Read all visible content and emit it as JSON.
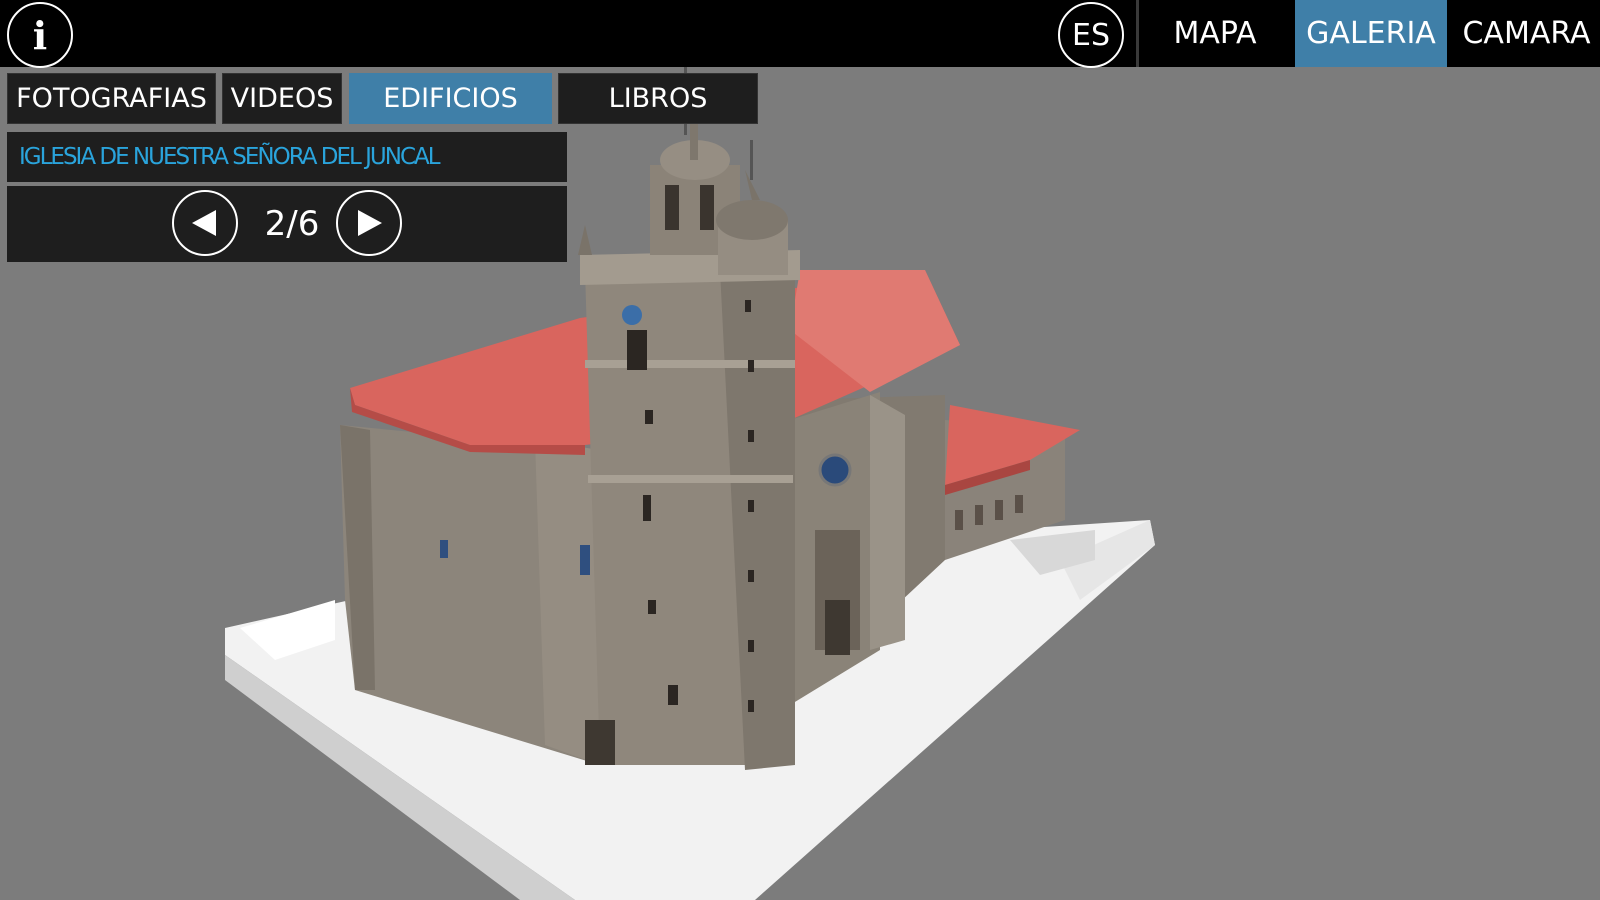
{
  "topbar": {
    "info_icon": "info-icon",
    "language": "ES",
    "nav": [
      {
        "label": "MAPA",
        "active": false
      },
      {
        "label": "GALERIA",
        "active": true
      },
      {
        "label": "CAMARA",
        "active": false
      }
    ]
  },
  "subtabs": [
    {
      "label": "FOTOGRAFIAS",
      "active": false
    },
    {
      "label": "VIDEOS",
      "active": false
    },
    {
      "label": "EDIFICIOS",
      "active": true
    },
    {
      "label": "LIBROS",
      "active": false
    }
  ],
  "building": {
    "title": "IGLESIA DE NUESTRA SEÑORA DEL JUNCAL",
    "pager": {
      "counter": "2/6",
      "prev_icon": "triangle-left-icon",
      "next_icon": "triangle-right-icon"
    }
  },
  "colors": {
    "accent": "#3f7fa8",
    "title_text": "#2aa4dc",
    "background": "#7c7c7c",
    "roof": "#d9655e",
    "stone": "#8f877c"
  }
}
